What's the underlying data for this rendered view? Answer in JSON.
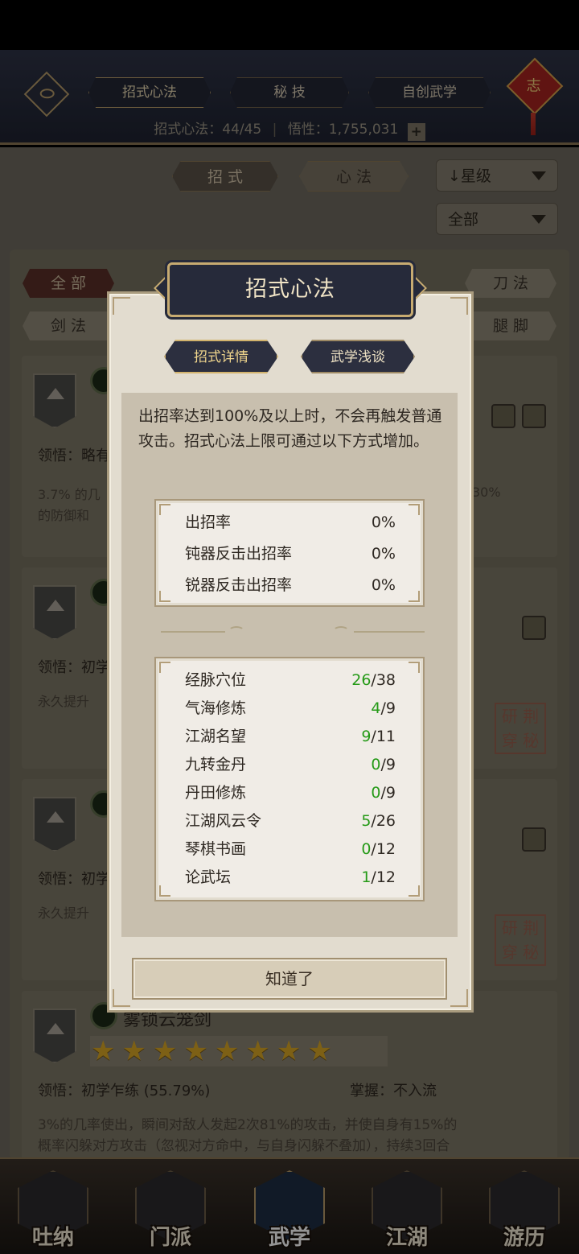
{
  "header": {
    "tabs": [
      "招式心法",
      "秘 技",
      "自创武学"
    ],
    "active_tab": 0,
    "knot_glyph": "志",
    "stats_label1": "招式心法：",
    "stats_value1": "44/45",
    "stats_label2": "悟性：",
    "stats_value2": "1,755,031",
    "plus": "+"
  },
  "sort": {
    "tab_moves": "招 式",
    "tab_heart": "心 法",
    "sort_dropdown": "星级",
    "sort_arrow": "↓",
    "filter_dropdown": "全部"
  },
  "categories": {
    "row1_left": "全 部",
    "row1_right": "刀 法",
    "row2_left": "剑 法",
    "row2_right": "腿 脚"
  },
  "cards": [
    {
      "line1": "领悟：略有",
      "line2a": "3.7% 的几",
      "line2b": "的防御和",
      "right_text": "30%"
    },
    {
      "line1": "领悟：初学",
      "line2a": "永久提升",
      "seal": "研 荆 穿 秘"
    },
    {
      "line1": "领悟：初学",
      "line2a": "永久提升",
      "seal": "研 荆 穿 秘"
    },
    {
      "name": "雾锁云笼剑",
      "line1": "领悟：初学乍练 (55.79%)",
      "line1_right": "掌握：不入流",
      "line2a": "3%的几率使出，瞬间对敌人发起2次81%的攻击，并使自身有15%的",
      "line2b": "概率闪躲对方攻击（忽视对方命中，与自身闪躲不叠加），持续3回合"
    }
  ],
  "bottom_nav": [
    "吐纳",
    "门派",
    "武学",
    "江湖",
    "游历"
  ],
  "bottom_nav_active": 2,
  "modal": {
    "title": "招式心法",
    "tab_detail": "招式详情",
    "tab_talk": "武学浅谈",
    "description": "出招率达到100%及以上时，不会再触发普通攻击。招式心法上限可通过以下方式增加。",
    "rates": [
      {
        "label": "出招率",
        "value": "0%"
      },
      {
        "label": "钝器反击出招率",
        "value": "0%"
      },
      {
        "label": "锐器反击出招率",
        "value": "0%"
      }
    ],
    "sources": [
      {
        "label": "经脉穴位",
        "current": "26",
        "max": "/38"
      },
      {
        "label": "气海修炼",
        "current": "4",
        "max": "/9"
      },
      {
        "label": "江湖名望",
        "current": "9",
        "max": "/11"
      },
      {
        "label": "九转金丹",
        "current": "0",
        "max": "/9"
      },
      {
        "label": "丹田修炼",
        "current": "0",
        "max": "/9"
      },
      {
        "label": "江湖风云令",
        "current": "5",
        "max": "/26"
      },
      {
        "label": "琴棋书画",
        "current": "0",
        "max": "/12"
      },
      {
        "label": "论武坛",
        "current": "1",
        "max": "/12"
      }
    ],
    "ok_button": "知道了"
  },
  "colors": {
    "accent_green": "#259a17",
    "gold": "#c7ab71",
    "dark_plate": "#262a3a"
  },
  "icons": [
    "eye-icon",
    "star-icon",
    "up-arrow-icon",
    "plus-icon"
  ]
}
